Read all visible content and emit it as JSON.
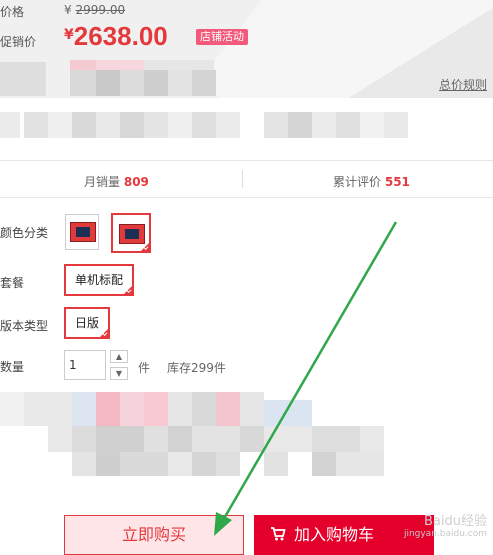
{
  "price": {
    "original_label": "价格",
    "original_currency": "¥",
    "original_value": "2999.00",
    "promo_label": "促销价",
    "promo_currency": "¥",
    "promo_value": "2638.00",
    "promo_badge": "店铺活动",
    "rules_link": "总价规则"
  },
  "stats": {
    "monthly_sales_label": "月销量",
    "monthly_sales_value": "809",
    "reviews_label": "累计评价",
    "reviews_value": "551"
  },
  "options": {
    "color_label": "颜色分类",
    "package_label": "套餐",
    "package_value": "单机标配",
    "version_label": "版本类型",
    "version_value": "日版"
  },
  "quantity": {
    "label": "数量",
    "value": "1",
    "unit": "件",
    "stock": "库存299件"
  },
  "actions": {
    "buy_now": "立即购买",
    "add_to_cart": "加入购物车"
  },
  "watermark": {
    "line1": "Baidu经验",
    "line2": "jingyan.baidu.com"
  },
  "colors": {
    "accent": "#e4393c",
    "cart_bg": "#e4002b",
    "badge": "#f2597b",
    "arrow": "#2ea84a"
  }
}
